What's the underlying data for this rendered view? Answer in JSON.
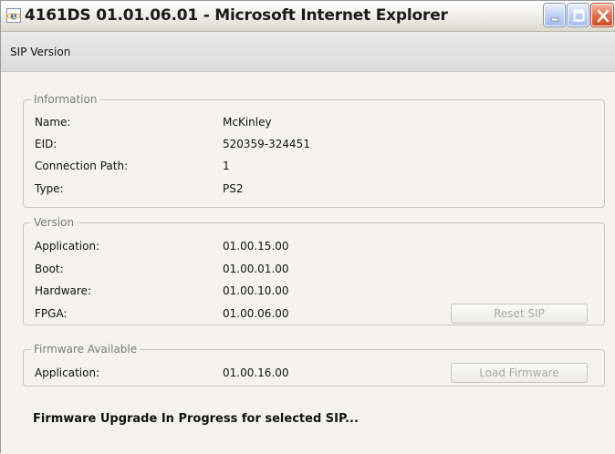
{
  "window": {
    "title": "4161DS 01.01.06.01 - Microsoft Internet Explorer",
    "controls": [
      "minimize-icon",
      "maximize-icon",
      "close-icon"
    ]
  },
  "header": {
    "title": "SIP Version"
  },
  "information": {
    "legend": "Information",
    "rows": [
      {
        "label": "Name:",
        "value": "McKinley"
      },
      {
        "label": "EID:",
        "value": "520359-324451"
      },
      {
        "label": "Connection Path:",
        "value": "1"
      },
      {
        "label": "Type:",
        "value": "PS2"
      }
    ]
  },
  "version": {
    "legend": "Version",
    "rows": [
      {
        "label": "Application:",
        "value": "01.00.15.00"
      },
      {
        "label": "Boot:",
        "value": "01.00.01.00"
      },
      {
        "label": "Hardware:",
        "value": "01.00.10.00"
      },
      {
        "label": "FPGA:",
        "value": "01.00.06.00"
      }
    ],
    "button_label": "Reset SIP"
  },
  "firmware": {
    "legend": "Firmware Available",
    "rows": [
      {
        "label": "Application:",
        "value": "01.00.16.00"
      }
    ],
    "button_label": "Load Firmware"
  },
  "status": {
    "text": "Firmware Upgrade In Progress for selected SIP..."
  },
  "colors": {
    "titlebar": "#eceae3",
    "panel": "#f4f3ee",
    "close": "#e5704b",
    "min_max": "#c1d2f6"
  }
}
